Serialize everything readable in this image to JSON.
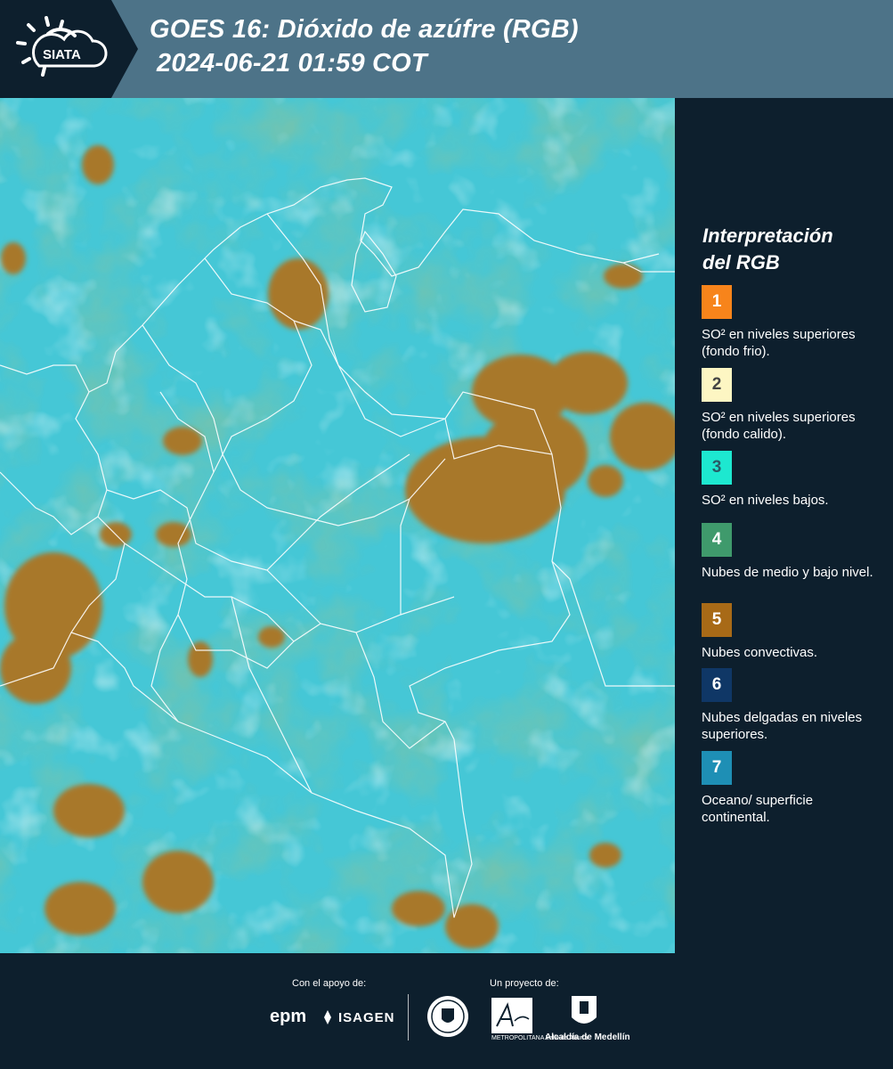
{
  "header": {
    "logo_text": "SIATA",
    "title_line1": "GOES 16: Dióxido de azúfre (RGB)",
    "title_line2": "2024-06-21 01:59 COT"
  },
  "map": {
    "description_icon": "satellite-rgb-map",
    "colors": {
      "ocean_land": "#3fc4d2",
      "low_clouds": "#2f8d6c",
      "convective": "#a8782a",
      "high_cloud": "#cfeef3"
    }
  },
  "legend": {
    "title_line1": "Interpretación",
    "title_line2": "del RGB",
    "items": [
      {
        "number": "1",
        "label": "SO² en niveles superiores (fondo frio).",
        "color": "#f7841b",
        "text_color": "#ffffff"
      },
      {
        "number": "2",
        "label": "SO² en niveles superiores (fondo calido).",
        "color": "#fdf6c3",
        "text_color": "#444444"
      },
      {
        "number": "3",
        "label": "SO² en niveles bajos.",
        "color": "#1de8d0",
        "text_color": "#2a5a66"
      },
      {
        "number": "4",
        "label": "Nubes de medio y bajo nivel.",
        "color": "#3f9a6c",
        "text_color": "#ffffff"
      },
      {
        "number": "5",
        "label": "Nubes convectivas.",
        "color": "#a86a17",
        "text_color": "#ffffff"
      },
      {
        "number": "6",
        "label": "Nubes delgadas en niveles superiores.",
        "color": "#0f3766",
        "text_color": "#ffffff"
      },
      {
        "number": "7",
        "label": "Oceano/ superficie continental.",
        "color": "#1e8fb5",
        "text_color": "#ffffff"
      }
    ]
  },
  "footer": {
    "support_label": "Con el apoyo de:",
    "project_label": "Un proyecto de:",
    "epm": "epm",
    "isagen": "ISAGEN",
    "area_text": "METROPOLITANA Valle de Aburrá",
    "alcaldia": "Alcaldía de Medellín"
  }
}
